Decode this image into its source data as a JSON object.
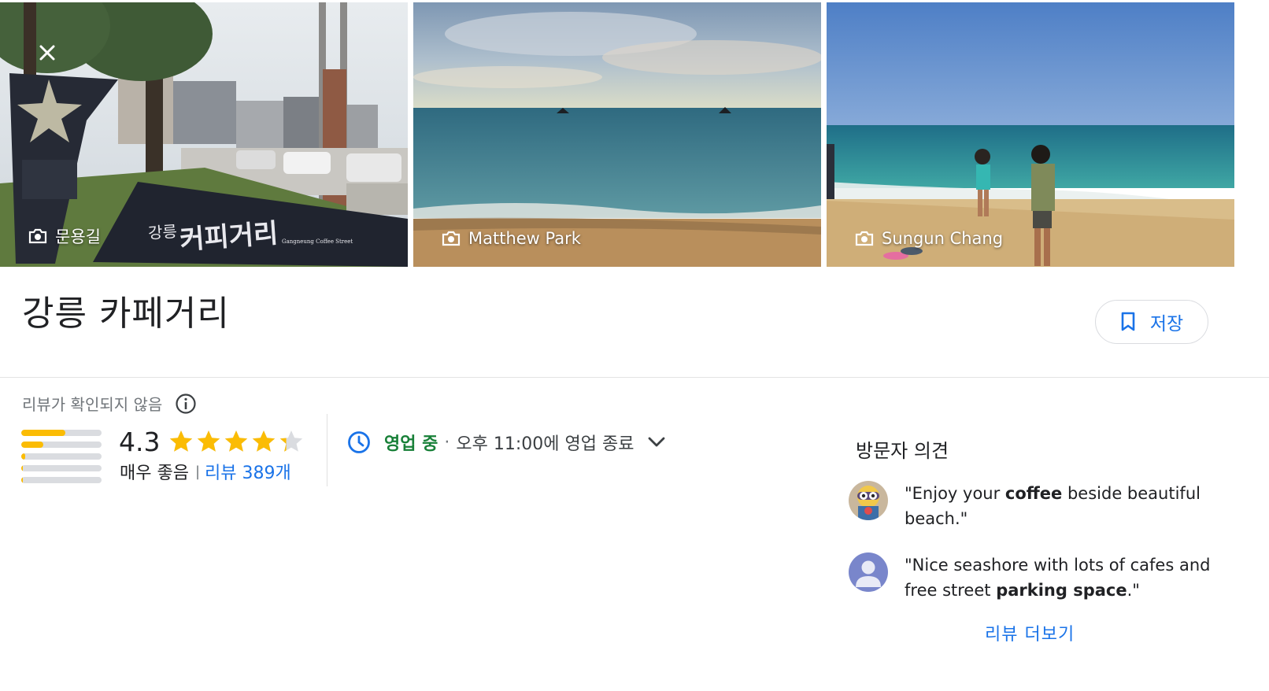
{
  "photos": [
    {
      "credit": "문용길",
      "sign_text": "커피거리",
      "sign_prefix": "강릉",
      "sign_subtext": "Gangneung Coffee Street"
    },
    {
      "credit": "Matthew Park"
    },
    {
      "credit": "Sungun Chang"
    }
  ],
  "icons": {
    "close": "close-icon",
    "camera": "camera-icon",
    "bookmark": "bookmark-icon",
    "info": "info-icon",
    "clock": "clock-icon",
    "chevron": "chevron-down-icon",
    "star": "star-icon"
  },
  "place": {
    "title": "강릉 카페거리"
  },
  "save": {
    "label": "저장"
  },
  "rating": {
    "unverified_label": "리뷰가 확인되지 않음",
    "score": "4.3",
    "score_value": 4.3,
    "stars_max": 5,
    "descriptor": "매우 좋음",
    "separator": "|",
    "review_count_label": "리뷰 389개",
    "distribution": [
      0.55,
      0.27,
      0.05,
      0.02,
      0.02
    ]
  },
  "hours": {
    "status": "영업 중",
    "separator": "·",
    "closing": "오후 11:00에 영업 종료"
  },
  "opinions": {
    "title": "방문자 의견",
    "reviews": [
      {
        "pre": "\"Enjoy your ",
        "bold": "coffee",
        "post": " beside beautiful beach.\""
      },
      {
        "pre": "\"Nice seashore with lots of cafes and free street ",
        "bold": "parking space",
        "post": ".\""
      }
    ],
    "more_label": "리뷰 더보기"
  },
  "colors": {
    "accent": "#1a73e8",
    "open_green": "#188038",
    "star_yellow": "#fbbc04",
    "star_empty": "#dadce0"
  }
}
